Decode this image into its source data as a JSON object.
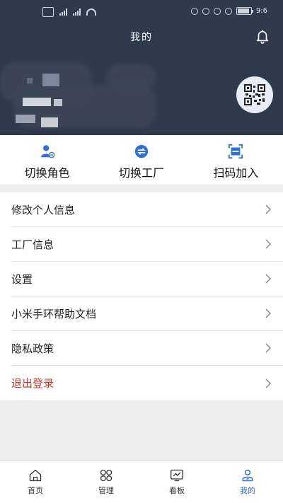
{
  "status_bar": {
    "time": "9:6",
    "battery": "89"
  },
  "header": {
    "title": "我的"
  },
  "quick_actions": [
    {
      "label": "切换角色",
      "icon": "user-switch-icon"
    },
    {
      "label": "切换工厂",
      "icon": "factory-switch-icon"
    },
    {
      "label": "扫码加入",
      "icon": "scan-icon"
    }
  ],
  "menu": [
    {
      "label": "修改个人信息"
    },
    {
      "label": "工厂信息"
    },
    {
      "label": "设置"
    },
    {
      "label": "小米手环帮助文档"
    },
    {
      "label": "隐私政策"
    },
    {
      "label": "退出登录"
    }
  ],
  "tabs": [
    {
      "label": "首页",
      "icon": "home-icon"
    },
    {
      "label": "管理",
      "icon": "grid-icon"
    },
    {
      "label": "看板",
      "icon": "chart-board-icon"
    },
    {
      "label": "我的",
      "icon": "person-icon",
      "active": true
    }
  ],
  "colors": {
    "header_bg": "#2f3a4c",
    "logout": "#d0342c",
    "accent": "#2f6fd6"
  }
}
